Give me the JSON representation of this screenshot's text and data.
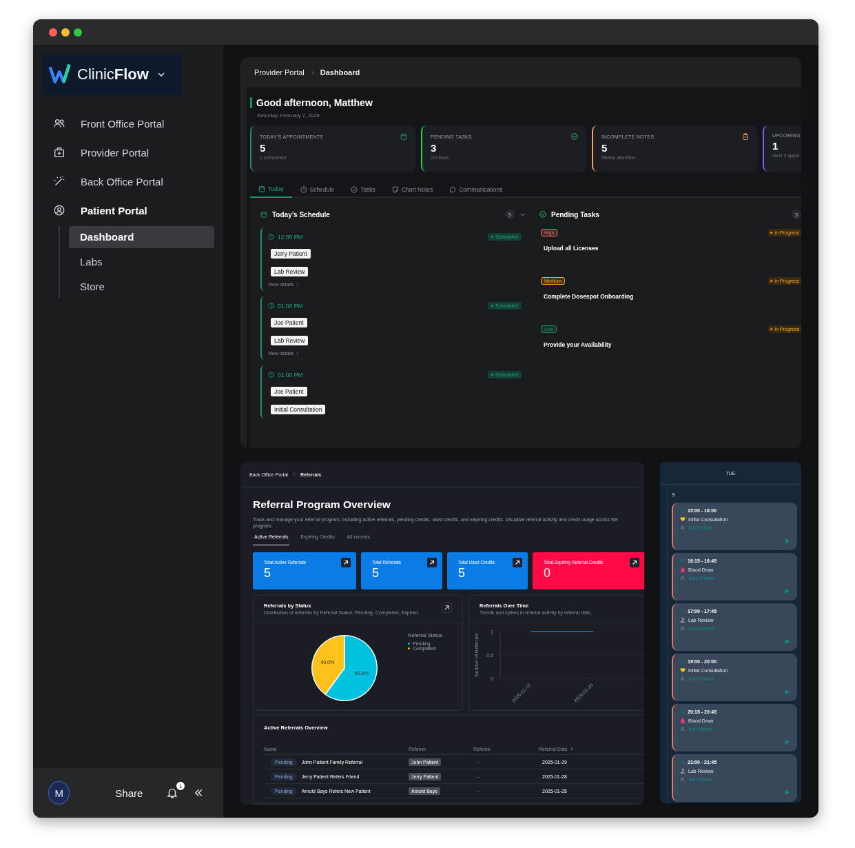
{
  "sidebar": {
    "brand": "Clinic**Flow**",
    "nav": [
      {
        "label": "Front Office Portal",
        "expanded": false
      },
      {
        "label": "Provider Portal",
        "expanded": false
      },
      {
        "label": "Back Office Portal",
        "expanded": false
      },
      {
        "label": "Patient Portal",
        "expanded": true,
        "children": [
          {
            "label": "Dashboard",
            "selected": true
          },
          {
            "label": "Labs",
            "selected": false
          },
          {
            "label": "Store",
            "selected": false
          }
        ]
      }
    ],
    "footer": {
      "avatar": "M",
      "share": "Share",
      "notifications": "1"
    }
  },
  "provider_dashboard": {
    "breadcrumb": [
      "Provider Portal",
      "Dashboard"
    ],
    "greeting": "Good afternoon, Matthew",
    "date": "Saturday, February 7, 2026",
    "stats": [
      {
        "label": "TODAY'S APPOINTMENTS",
        "value": "5",
        "note": "1 completed",
        "color": "#1f8f6e"
      },
      {
        "label": "PENDING TASKS",
        "value": "3",
        "note": "On track",
        "color": "#22c55e"
      },
      {
        "label": "INCOMPLETE NOTES",
        "value": "5",
        "note": "Needs attention",
        "color": "#f4a26b"
      },
      {
        "label": "UPCOMING",
        "value": "1",
        "note": "Next 5 appoi",
        "color": "#8b5cf6"
      }
    ],
    "tabs": [
      {
        "label": "Today",
        "selected": true
      },
      {
        "label": "Schedule",
        "selected": false
      },
      {
        "label": "Tasks",
        "selected": false
      },
      {
        "label": "Chart Notes",
        "selected": false
      },
      {
        "label": "Communications",
        "selected": false
      }
    ],
    "schedule": {
      "title": "Today’s Schedule",
      "count": "5",
      "expanded": true,
      "appointments": [
        {
          "time": "12:00 PM",
          "status": "Scheduled",
          "patient": "Jerry Patient",
          "type": "Lab Review",
          "details": "View details"
        },
        {
          "time": "01:00 PM",
          "status": "Scheduled",
          "patient": "Joe Patient",
          "type": "Lab Review",
          "details": "View details"
        },
        {
          "time": "01:00 PM",
          "status": "Scheduled",
          "patient": "Joe Patient",
          "type": "Initial Consultation"
        }
      ]
    },
    "tasks": {
      "title": "Pending Tasks",
      "count": "3",
      "items": [
        {
          "priority": "High",
          "color": "#f26d5b",
          "status": "In Progress",
          "title": "Upload all Licenses"
        },
        {
          "priority": "Medium",
          "color": "#f5a524",
          "status": "In Progress",
          "title": "Complete Dosespot Onboarding"
        },
        {
          "priority": "Low",
          "color": "#1f8f6e",
          "status": "In Progress",
          "title": "Provide your Availability"
        }
      ]
    }
  },
  "referrals": {
    "breadcrumb": [
      "Back Office Portal",
      "Referrals"
    ],
    "title": "Referral Program Overview",
    "description": "Track and manage your referral program, including active referrals, pending credits, used credits, and expiring credits. Visualize referral activity and credit usage across the program.",
    "tabs": [
      {
        "label": "Active Referrals",
        "selected": true
      },
      {
        "label": "Expiring Credits",
        "selected": false
      },
      {
        "label": "All records",
        "selected": false
      }
    ],
    "stats": [
      {
        "label": "Total Active Referrals",
        "value": "5",
        "color": "#0b7be6"
      },
      {
        "label": "Total Referrals",
        "value": "5",
        "color": "#0b7be6"
      },
      {
        "label": "Total Used Credits",
        "value": "5",
        "color": "#0b7be6"
      },
      {
        "label": "Total Expiring Referral Credits",
        "value": "0",
        "color": "#ff0a47"
      }
    ],
    "status_chart": {
      "title": "Referrals by Status",
      "subtitle": "Distribution of referrals by Referral Status: Pending, Completed, Expired.",
      "chart_data": {
        "type": "pie",
        "categories": [
          "Pending",
          "Completed"
        ],
        "values": [
          60,
          40
        ],
        "colors": [
          "#00c2e0",
          "#fcc21b"
        ],
        "value_labels": [
          "60.0%",
          "40.0%"
        ],
        "legend": "right"
      },
      "legend_title": "Referral Status"
    },
    "time_chart": {
      "title": "Referrals Over Time",
      "subtitle": "Trends and spikes in referral activity by referral date.",
      "chart_data": {
        "type": "line",
        "ylabel": "Number of Referrals",
        "x": [
          "2025-01-15",
          "2025-01-20"
        ],
        "series": [
          {
            "color": "#3b9ae1",
            "values": [
              1,
              1
            ]
          }
        ],
        "ylim": [
          0,
          1
        ],
        "yticks": [
          0,
          0.5,
          1
        ]
      }
    },
    "table": {
      "title": "Active Referrals Overview",
      "columns": [
        {
          "label": "Name",
          "sorted": false
        },
        {
          "label": "Referrer",
          "sorted": false
        },
        {
          "label": "Referee",
          "sorted": false
        },
        {
          "label": "Referral Date",
          "sorted": true
        }
      ],
      "rows": [
        {
          "status": "Pending",
          "name": "John Patient Family Referral",
          "referrer": "John Patient",
          "referee": "–",
          "date": "2025-01-29"
        },
        {
          "status": "Pending",
          "name": "Jerry Patient Refers Friend",
          "referrer": "Jerry Patient",
          "referee": "–",
          "date": "2025-01-28"
        },
        {
          "status": "Pending",
          "name": "Arnold Bays Refers New Patient",
          "referrer": "Arnold Bays",
          "referee": "–",
          "date": "2025-01-25"
        }
      ]
    }
  },
  "calendar": {
    "day_label": "TUE",
    "date": "3",
    "events": [
      {
        "time": "15:00 - 16:00",
        "kind": "consultation",
        "title": "Initial Consultation",
        "patient": "Joe Patient"
      },
      {
        "time": "16:15 - 16:45",
        "kind": "blood",
        "title": "Blood Draw",
        "patient": "Jerry Patient"
      },
      {
        "time": "17:00 - 17:45",
        "kind": "lab",
        "title": "Lab Review",
        "patient": "John Patient"
      },
      {
        "time": "19:00 - 20:00",
        "kind": "consultation",
        "title": "Initial Consultation",
        "patient": "Jerry Patient"
      },
      {
        "time": "20:15 - 20:45",
        "kind": "blood",
        "title": "Blood Draw",
        "patient": "Joe Patient"
      },
      {
        "time": "21:00 - 21:45",
        "kind": "lab",
        "title": "Lab Review",
        "patient": "Joe Patient"
      }
    ]
  }
}
